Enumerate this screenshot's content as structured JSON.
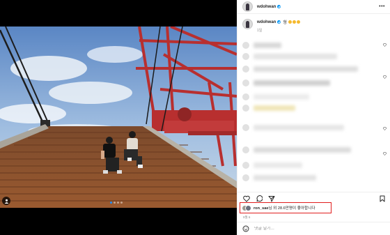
{
  "post": {
    "username": "wdohwan",
    "caption_text": "형",
    "caption_emojis": [
      "smiling-face",
      "smiling-face",
      "smiling-face"
    ],
    "time_ago": "1일",
    "carousel": {
      "slide_count": 4,
      "active_index": 0
    },
    "likes": {
      "liker": "ron_sae",
      "text_suffix": "님 외 28.6만명이 좋아합니다"
    },
    "date": "9월 6",
    "comment_placeholder": "댓글 달기..."
  },
  "colors": {
    "accent": "#0095f6",
    "highlight_box": "#e11d1d",
    "crane_red": "#b82f2f",
    "ramp_rust": "#8a4f2a"
  },
  "icons": [
    "more-icon",
    "verified-icon",
    "heart-icon",
    "comment-icon",
    "share-icon",
    "bookmark-icon",
    "emoji-icon",
    "user-tag-icon"
  ]
}
